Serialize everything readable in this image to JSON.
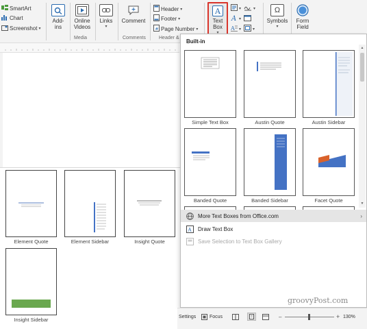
{
  "ribbon": {
    "illustrations": {
      "smartart": "SmartArt",
      "chart": "Chart",
      "screenshot": "Screenshot"
    },
    "addins": "Add-ins",
    "online_videos": "Online Videos",
    "links": "Links",
    "comment": "Comment",
    "header_footer": {
      "header": "Header",
      "footer": "Footer",
      "page_number": "Page Number"
    },
    "text_box": "Text Box",
    "symbols": "Symbols",
    "form_field": "Form Field",
    "groups": {
      "media": "Media",
      "comments": "Comments",
      "header_footer": "Header & F"
    }
  },
  "gallery": {
    "section_label": "Built-in",
    "items": [
      {
        "label": "Simple Text Box"
      },
      {
        "label": "Austin Quote"
      },
      {
        "label": "Austin Sidebar"
      },
      {
        "label": "Banded Quote"
      },
      {
        "label": "Banded Sidebar"
      },
      {
        "label": "Facet Quote"
      }
    ]
  },
  "lower_gallery": {
    "items": [
      {
        "label": "Element Quote"
      },
      {
        "label": "Element Sidebar"
      },
      {
        "label": "Insight Quote"
      },
      {
        "label": "Insight Sidebar"
      }
    ]
  },
  "menu": {
    "more": "More Text Boxes from Office.com",
    "draw": "Draw Text Box",
    "save": "Save Selection to Text Box Gallery"
  },
  "status": {
    "settings": "Settings",
    "focus": "Focus",
    "zoom": "130%"
  },
  "watermark": "groovyPost.com",
  "colors": {
    "accent_blue": "#2b6cb0",
    "selected_red": "#d9342b",
    "green_band": "#6aa84f",
    "sidebar_blue": "#4472c4"
  }
}
